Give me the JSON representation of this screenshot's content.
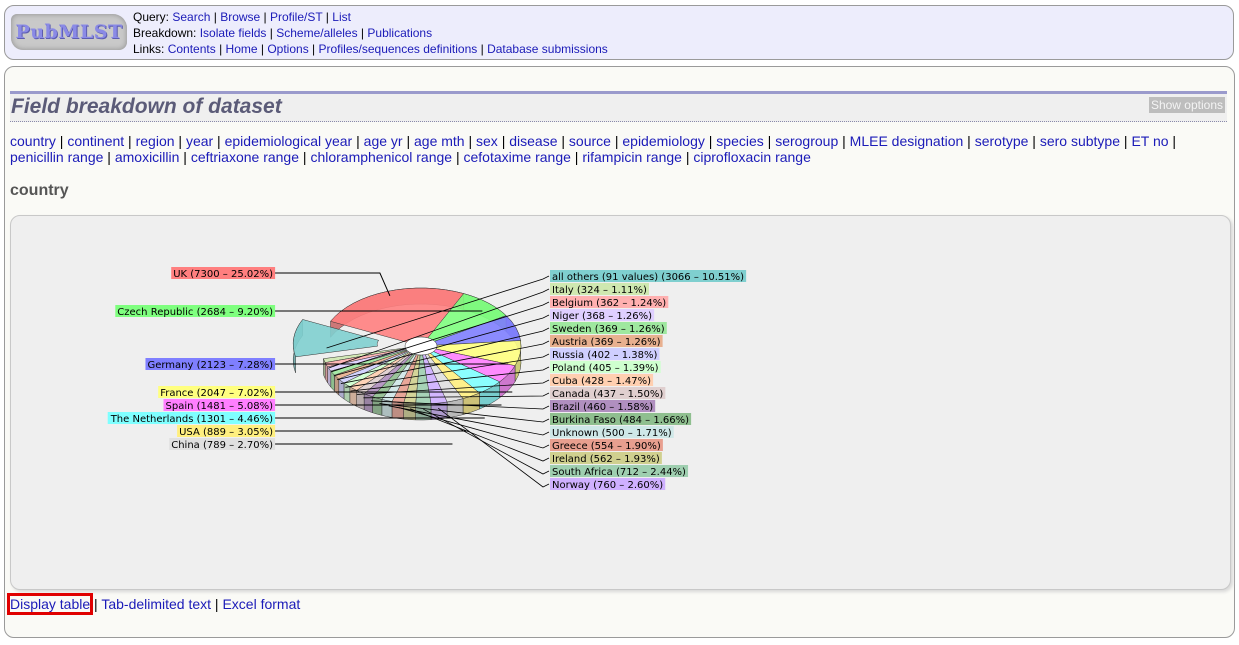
{
  "header": {
    "logo": "PubMLST",
    "rows": [
      {
        "label": "Query:",
        "links": [
          "Search",
          "Browse",
          "Profile/ST",
          "List"
        ]
      },
      {
        "label": "Breakdown:",
        "links": [
          "Isolate fields",
          "Scheme/alleles",
          "Publications"
        ]
      },
      {
        "label": "Links:",
        "links": [
          "Contents",
          "Home",
          "Options",
          "Profiles/sequences definitions",
          "Database submissions"
        ]
      }
    ]
  },
  "page": {
    "title": "Field breakdown of dataset",
    "show_options": "Show options",
    "fields": [
      "country",
      "continent",
      "region",
      "year",
      "epidemiological year",
      "age yr",
      "age mth",
      "sex",
      "disease",
      "source",
      "epidemiology",
      "species",
      "serogroup",
      "MLEE designation",
      "serotype",
      "sero subtype",
      "ET no",
      "penicillin range",
      "amoxicillin",
      "ceftriaxone range",
      "chloramphenicol range",
      "cefotaxime range",
      "rifampicin range",
      "ciprofloxacin range"
    ],
    "selected_field": "country"
  },
  "footer": {
    "links": [
      "Display table",
      "Tab-delimited text",
      "Excel format"
    ],
    "highlighted": "Display table"
  },
  "chart_data": {
    "type": "pie",
    "title": "country",
    "style": "3d-exploded",
    "slices": [
      {
        "label": "UK",
        "value": 7300,
        "percent": 25.02,
        "color": "#ff7f7f",
        "side": "left"
      },
      {
        "label": "Czech Republic",
        "value": 2684,
        "percent": 9.2,
        "color": "#7fff7f",
        "side": "left"
      },
      {
        "label": "Germany",
        "value": 2123,
        "percent": 7.28,
        "color": "#7f7fff",
        "side": "left"
      },
      {
        "label": "France",
        "value": 2047,
        "percent": 7.02,
        "color": "#ffff7f",
        "side": "left"
      },
      {
        "label": "Spain",
        "value": 1481,
        "percent": 5.08,
        "color": "#ff7fff",
        "side": "left"
      },
      {
        "label": "The Netherlands",
        "value": 1301,
        "percent": 4.46,
        "color": "#7fffff",
        "side": "left"
      },
      {
        "label": "USA",
        "value": 889,
        "percent": 3.05,
        "color": "#ffef7f",
        "side": "left"
      },
      {
        "label": "China",
        "value": 789,
        "percent": 2.7,
        "color": "#e0e0e0",
        "side": "left"
      },
      {
        "label": "Norway",
        "value": 760,
        "percent": 2.6,
        "color": "#cfb0ff",
        "side": "right"
      },
      {
        "label": "South Africa",
        "value": 712,
        "percent": 2.44,
        "color": "#9fcfb0",
        "side": "right"
      },
      {
        "label": "Ireland",
        "value": 562,
        "percent": 1.93,
        "color": "#d0d08f",
        "side": "right"
      },
      {
        "label": "Greece",
        "value": 554,
        "percent": 1.9,
        "color": "#e89f8f",
        "side": "right"
      },
      {
        "label": "Unknown",
        "value": 500,
        "percent": 1.71,
        "color": "#cfe8e8",
        "side": "right"
      },
      {
        "label": "Burkina Faso",
        "value": 484,
        "percent": 1.66,
        "color": "#8fbf8f",
        "side": "right"
      },
      {
        "label": "Brazil",
        "value": 460,
        "percent": 1.58,
        "color": "#b08fbf",
        "side": "right"
      },
      {
        "label": "Canada",
        "value": 437,
        "percent": 1.5,
        "color": "#e0cfcf",
        "side": "right"
      },
      {
        "label": "Cuba",
        "value": 428,
        "percent": 1.47,
        "color": "#ffcfb0",
        "side": "right"
      },
      {
        "label": "Poland",
        "value": 405,
        "percent": 1.39,
        "color": "#cfffcf",
        "side": "right"
      },
      {
        "label": "Russia",
        "value": 402,
        "percent": 1.38,
        "color": "#cfcfff",
        "side": "right"
      },
      {
        "label": "Austria",
        "value": 369,
        "percent": 1.26,
        "color": "#e8b08f",
        "side": "right"
      },
      {
        "label": "Sweden",
        "value": 369,
        "percent": 1.26,
        "color": "#9fe89f",
        "side": "right"
      },
      {
        "label": "Niger",
        "value": 368,
        "percent": 1.26,
        "color": "#dfcfff",
        "side": "right"
      },
      {
        "label": "Belgium",
        "value": 362,
        "percent": 1.24,
        "color": "#ffb0b0",
        "side": "right"
      },
      {
        "label": "Italy",
        "value": 324,
        "percent": 1.11,
        "color": "#cfe8b0",
        "side": "right"
      },
      {
        "label": "all others (91 values)",
        "value": 3066,
        "percent": 10.51,
        "color": "#7fcfcf",
        "side": "right"
      }
    ]
  }
}
